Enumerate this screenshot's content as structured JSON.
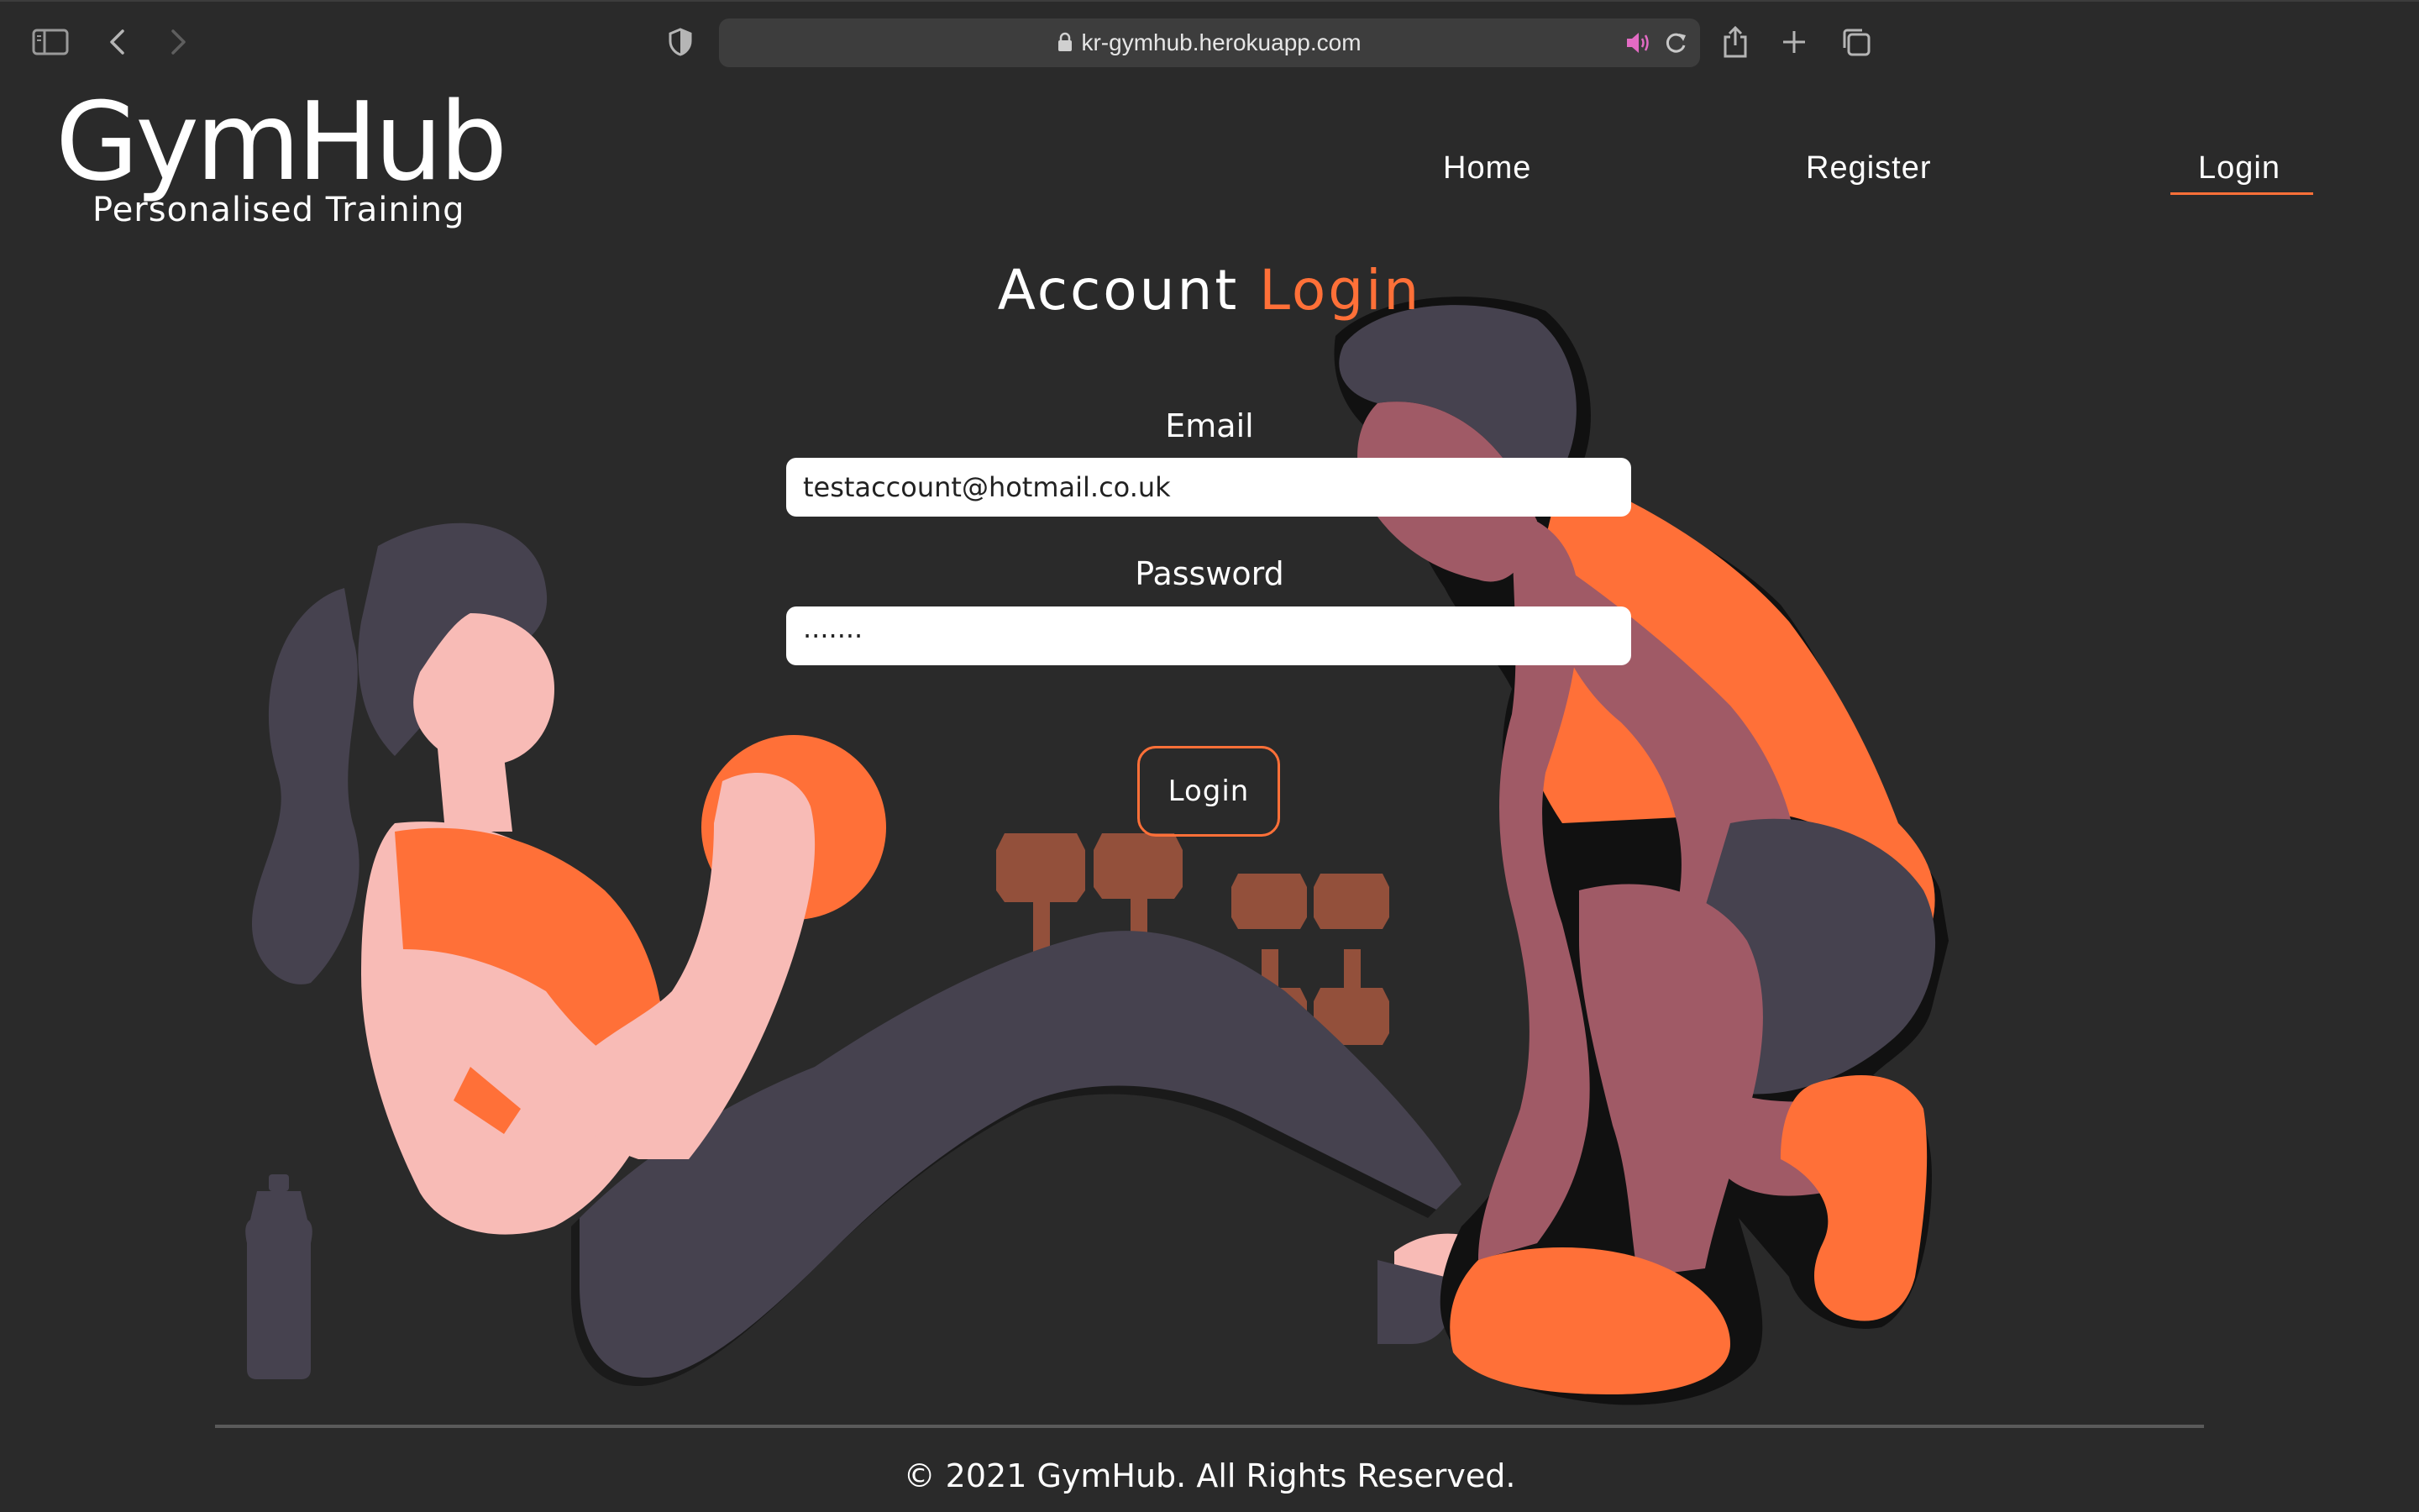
{
  "browser": {
    "url": "kr-gymhub.herokuapp.com"
  },
  "site": {
    "logo_title": "GymHub",
    "logo_subtitle": "Personalised Training"
  },
  "nav": {
    "items": [
      {
        "label": "Home",
        "active": false
      },
      {
        "label": "Register",
        "active": false
      },
      {
        "label": "Login",
        "active": true
      }
    ]
  },
  "form": {
    "heading_prefix": "Account",
    "heading_accent": "Login",
    "email_label": "Email",
    "email_value": "testaccount@hotmail.co.uk",
    "password_label": "Password",
    "password_value": "·······",
    "submit_label": "Login"
  },
  "footer": {
    "text": "© 2021 GymHub. All Rights Reserved."
  },
  "colors": {
    "background": "#2a2a2a",
    "accent": "#ff7038",
    "figure_dark": "#46424f",
    "skin_light": "#f8bbb6",
    "skin_dark": "#a05a66",
    "dumbbell": "#93503b"
  }
}
